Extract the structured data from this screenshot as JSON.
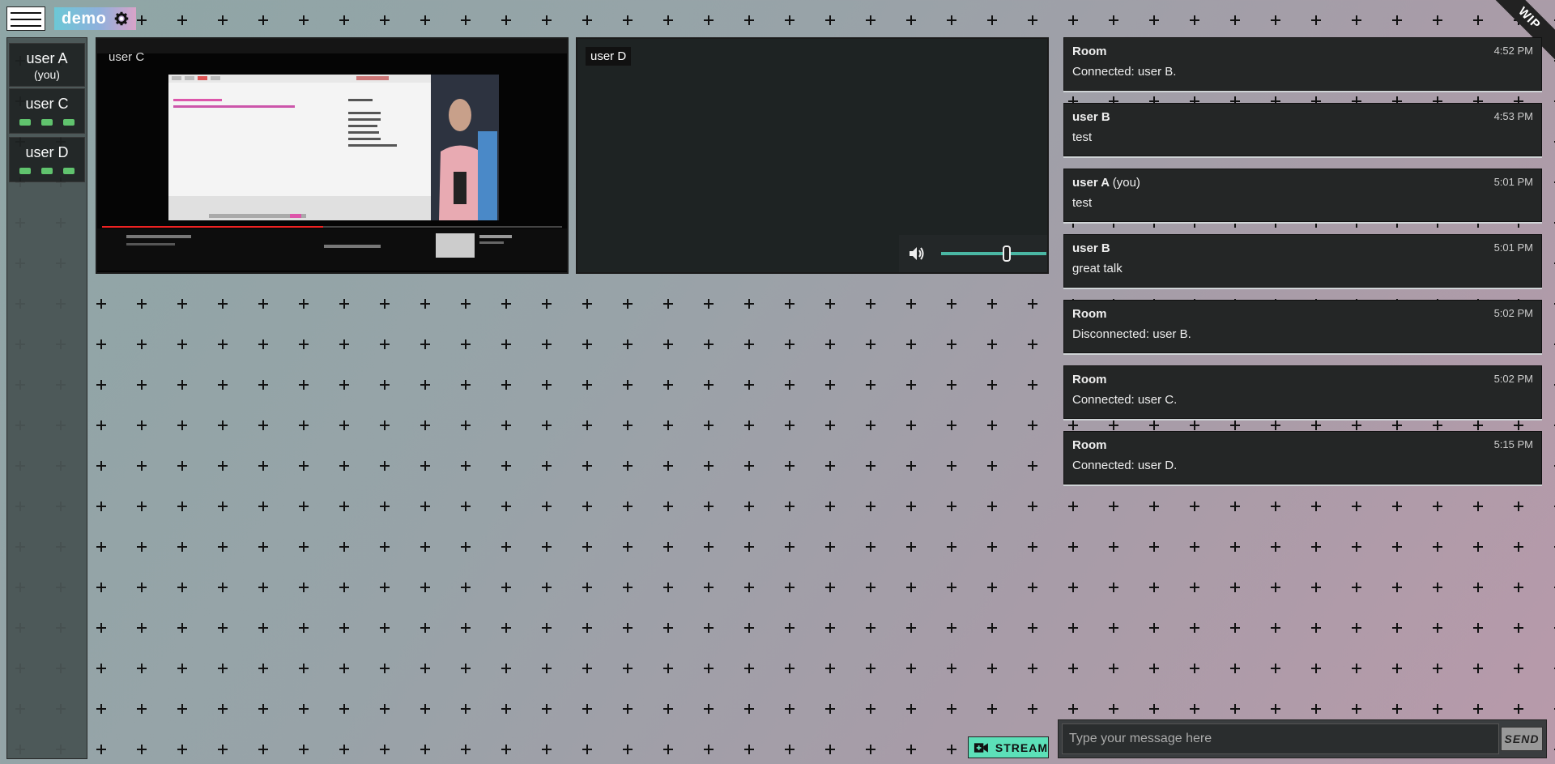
{
  "room": {
    "name": "demo",
    "ribbon": "WIP"
  },
  "users": [
    {
      "name": "user A",
      "sub": "(you)",
      "dots": 0
    },
    {
      "name": "user C",
      "sub": "",
      "dots": 3
    },
    {
      "name": "user D",
      "sub": "",
      "dots": 3
    }
  ],
  "videos": [
    {
      "label": "user C"
    },
    {
      "label": "user D",
      "volume": 0.62
    }
  ],
  "messages": [
    {
      "author": "Room",
      "you": "",
      "time": "4:52 PM",
      "text": "Connected: user B."
    },
    {
      "author": "user B",
      "you": "",
      "time": "4:53 PM",
      "text": "test"
    },
    {
      "author": "user A",
      "you": "(you)",
      "time": "5:01 PM",
      "text": "test"
    },
    {
      "author": "user B",
      "you": "",
      "time": "5:01 PM",
      "text": "great talk"
    },
    {
      "author": "Room",
      "you": "",
      "time": "5:02 PM",
      "text": "Disconnected: user B."
    },
    {
      "author": "Room",
      "you": "",
      "time": "5:02 PM",
      "text": "Connected: user C."
    },
    {
      "author": "Room",
      "you": "",
      "time": "5:15 PM",
      "text": "Connected: user D."
    }
  ],
  "controls": {
    "stream_label": "STREAM",
    "send_label": "SEND",
    "input_placeholder": "Type your message here"
  },
  "colors": {
    "accent": "#5ce0b8",
    "active_dot": "#5ec56b",
    "panel": "#242626"
  },
  "icons": [
    "menu-icon",
    "gear-icon",
    "volume-icon",
    "stream-icon"
  ]
}
